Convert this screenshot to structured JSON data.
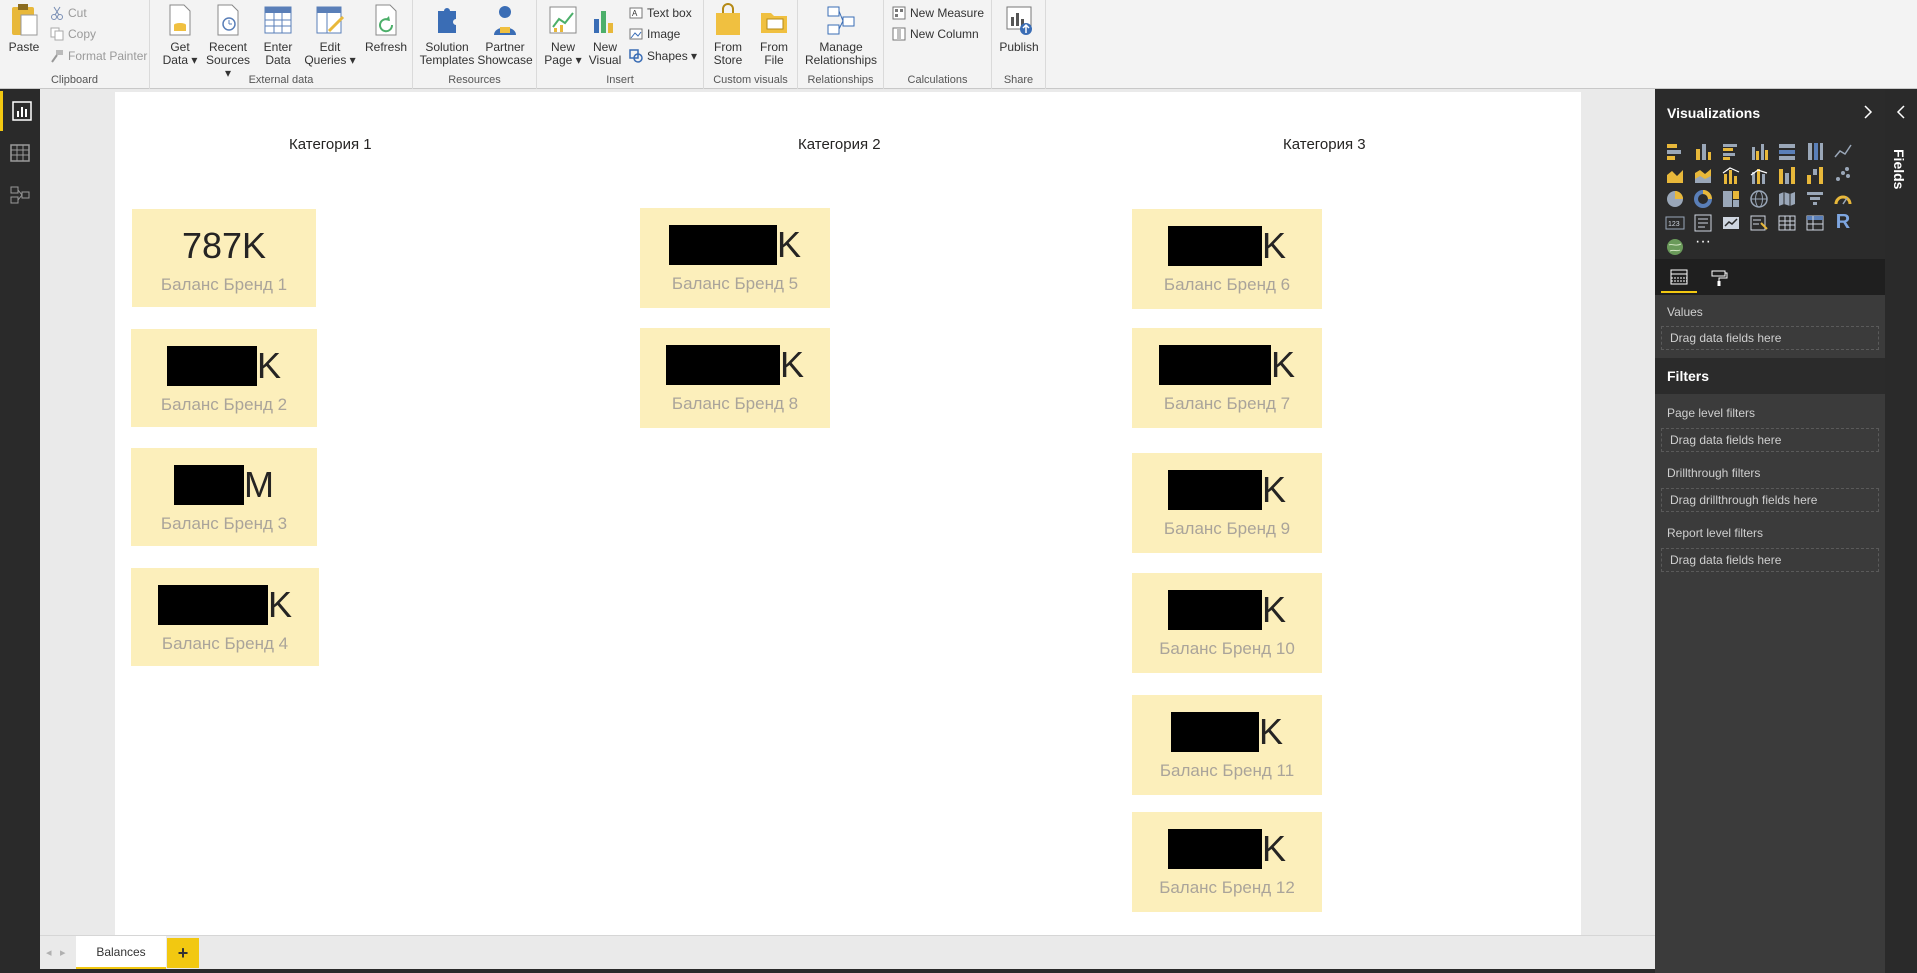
{
  "ribbon": {
    "clipboard": {
      "paste": "Paste",
      "cut": "Cut",
      "copy": "Copy",
      "format_painter": "Format Painter",
      "label": "Clipboard"
    },
    "external_data": {
      "get_data": "Get\nData ▾",
      "recent_sources": "Recent\nSources ▾",
      "enter_data": "Enter\nData",
      "edit_queries": "Edit\nQueries ▾",
      "refresh": "Refresh",
      "label": "External data"
    },
    "resources": {
      "solution_templates": "Solution\nTemplates",
      "partner_showcase": "Partner\nShowcase",
      "label": "Resources"
    },
    "insert": {
      "new_page": "New\nPage ▾",
      "new_visual": "New\nVisual",
      "text_box": "Text box",
      "image": "Image",
      "shapes": "Shapes ▾",
      "label": "Insert"
    },
    "custom_visuals": {
      "from_store": "From\nStore",
      "from_file": "From\nFile",
      "label": "Custom visuals"
    },
    "relationships": {
      "manage": "Manage\nRelationships",
      "label": "Relationships"
    },
    "calculations": {
      "new_measure": "New Measure",
      "new_column": "New Column",
      "label": "Calculations"
    },
    "share": {
      "publish": "Publish",
      "label": "Share"
    }
  },
  "report": {
    "categories": [
      "Категория 1",
      "Категория 2",
      "Категория 3"
    ],
    "cards": [
      {
        "value": "787K",
        "caption": "Баланс Бренд 1"
      },
      {
        "suffix": "K",
        "caption": "Баланс Бренд 2"
      },
      {
        "suffix": "M",
        "caption": "Баланс Бренд 3"
      },
      {
        "suffix": "K",
        "caption": "Баланс Бренд 4"
      },
      {
        "suffix": "K",
        "caption": "Баланс Бренд 5"
      },
      {
        "suffix": "K",
        "caption": "Баланс Бренд 8"
      },
      {
        "suffix": "K",
        "caption": "Баланс Бренд 6"
      },
      {
        "suffix": "K",
        "caption": "Баланс Бренд 7"
      },
      {
        "suffix": "K",
        "caption": "Баланс Бренд 9"
      },
      {
        "suffix": "K",
        "caption": "Баланс Бренд 10"
      },
      {
        "suffix": "K",
        "caption": "Баланс Бренд 11"
      },
      {
        "suffix": "K",
        "caption": "Баланс Бренд 12"
      }
    ]
  },
  "tabs": {
    "page": "Balances",
    "add": "+"
  },
  "visualizations": {
    "title": "Visualizations",
    "more": "···",
    "r_visual": "R",
    "values_label": "Values",
    "values_well": "Drag data fields here"
  },
  "filters": {
    "title": "Filters",
    "page_level": "Page level filters",
    "page_well": "Drag data fields here",
    "drillthrough": "Drillthrough filters",
    "drillthrough_well": "Drag drillthrough fields here",
    "report_level": "Report level filters",
    "report_well": "Drag data fields here"
  },
  "fields": {
    "label": "Fields"
  },
  "colors": {
    "accent": "#f2c811",
    "card_bg": "#fcefbb",
    "dark_panel": "#3b3b3b"
  }
}
